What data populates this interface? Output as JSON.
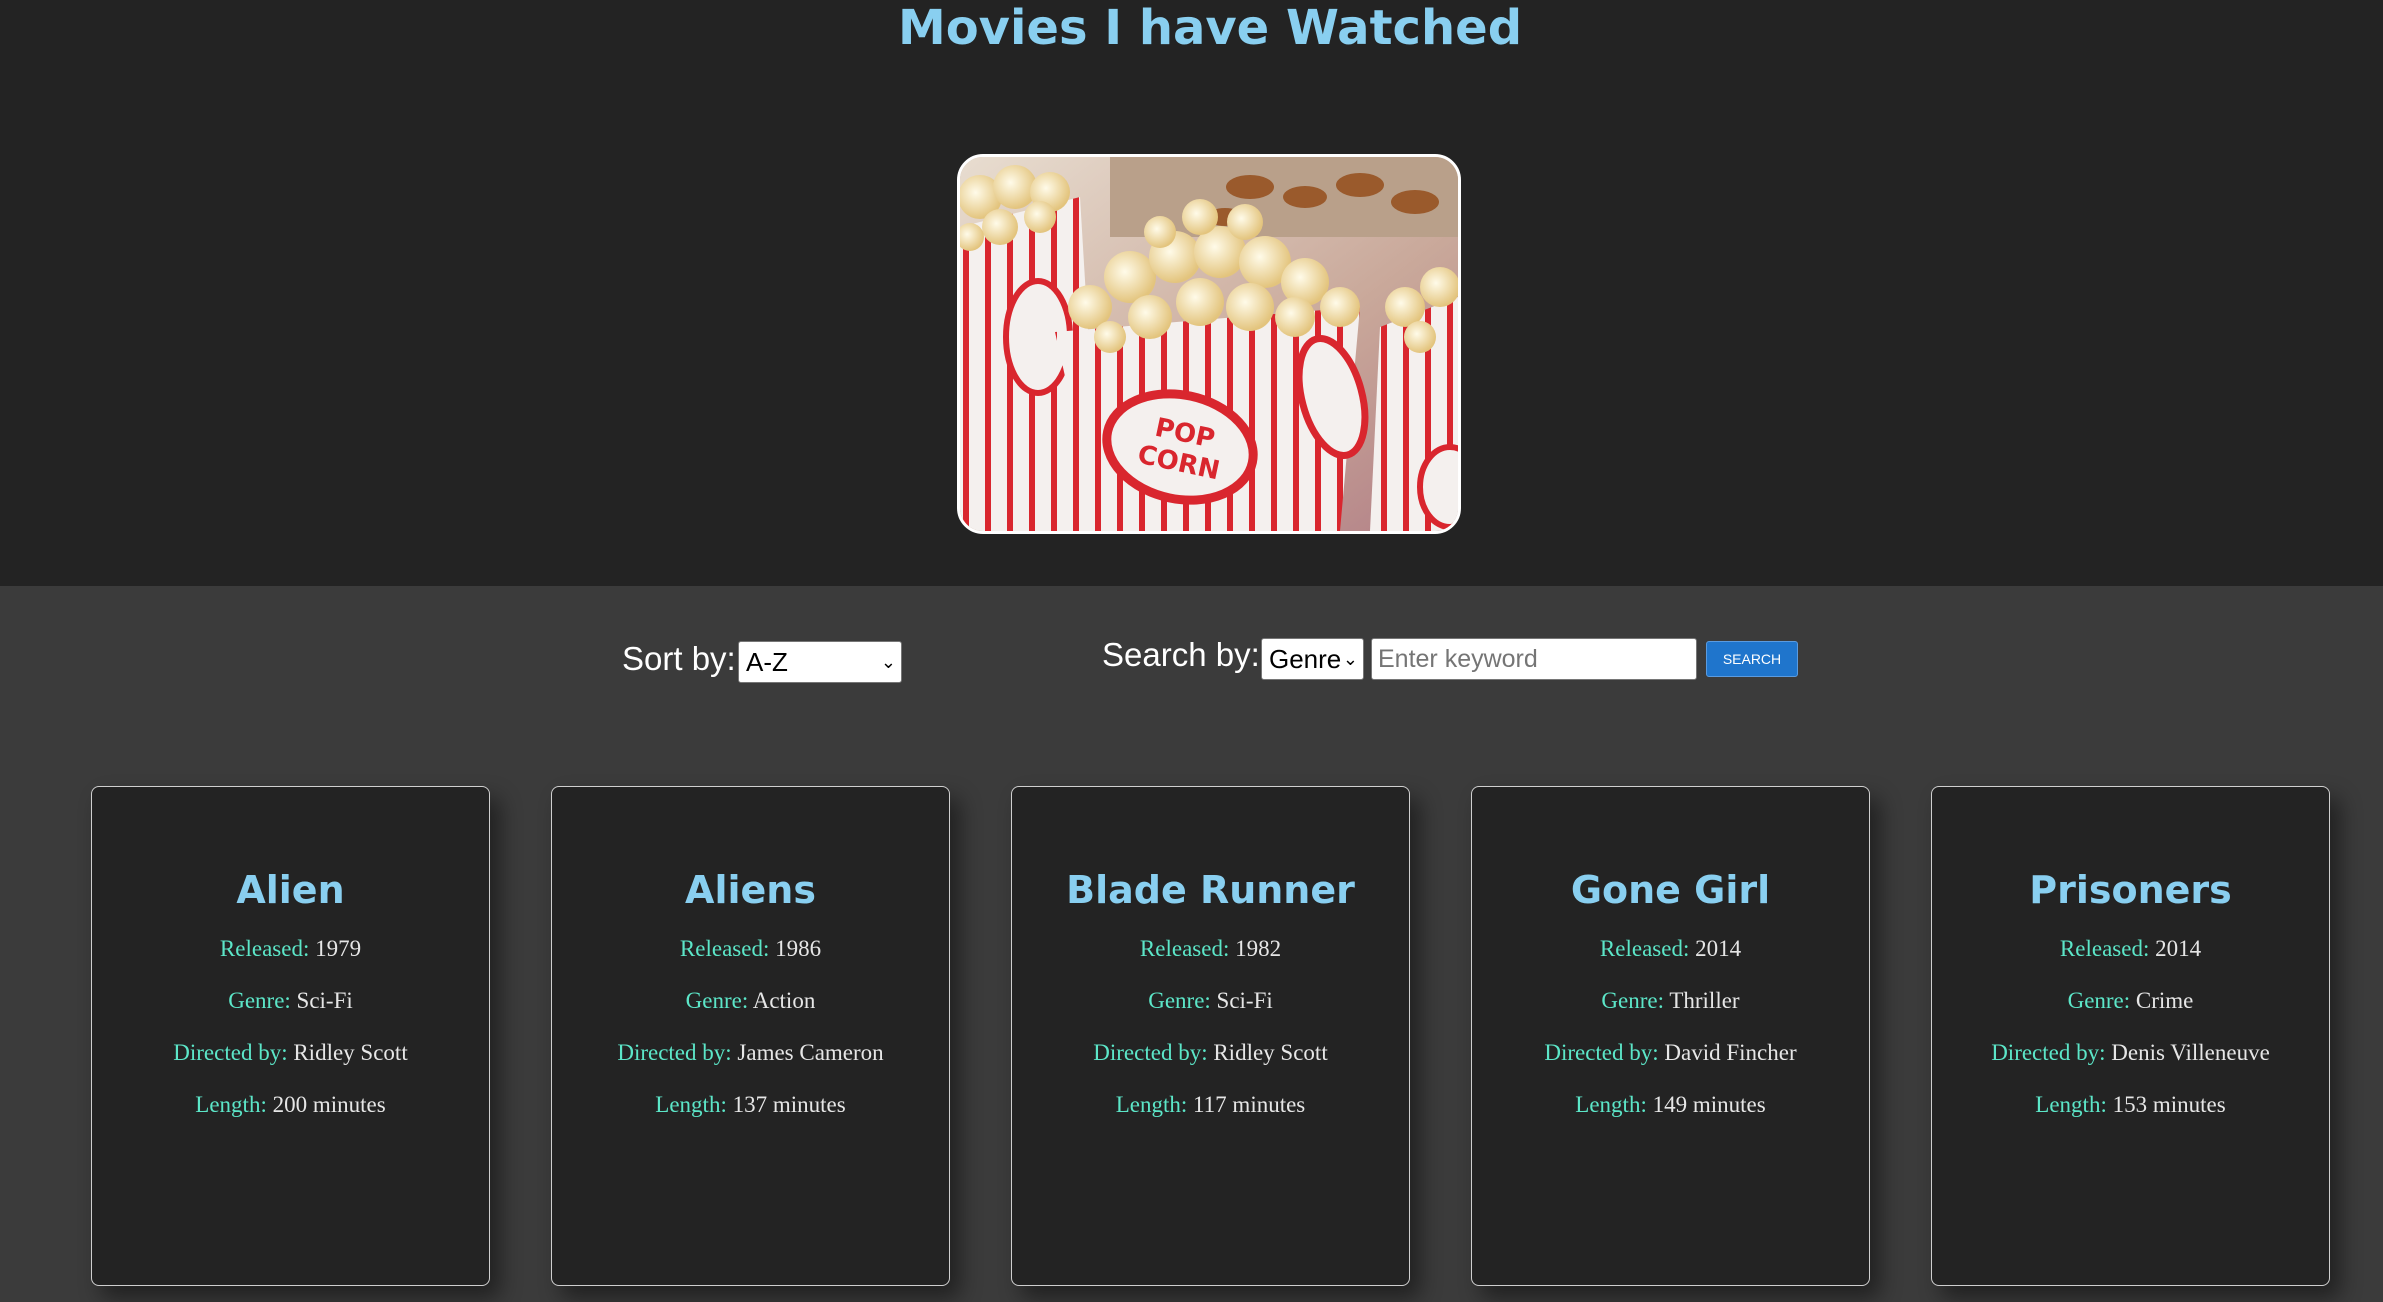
{
  "page": {
    "title": "Movies I have Watched"
  },
  "hero_image": {
    "description_icon": "popcorn-image",
    "box_text_line1": "POP",
    "box_text_line2": "CORN"
  },
  "controls": {
    "sort_label": "Sort by:",
    "sort_value": "A-Z",
    "search_label": "Search by:",
    "search_field_value": "Genre",
    "search_placeholder": "Enter keyword",
    "search_button": "SEARCH"
  },
  "field_labels": {
    "released": "Released:",
    "genre": "Genre:",
    "director": "Directed by:",
    "length": "Length:"
  },
  "movies": [
    {
      "title": "Alien",
      "released": "1979",
      "genre": "Sci-Fi",
      "director": "Ridley Scott",
      "length": "200 minutes"
    },
    {
      "title": "Aliens",
      "released": "1986",
      "genre": "Action",
      "director": "James Cameron",
      "length": "137 minutes"
    },
    {
      "title": "Blade Runner",
      "released": "1982",
      "genre": "Sci-Fi",
      "director": "Ridley Scott",
      "length": "117 minutes"
    },
    {
      "title": "Gone Girl",
      "released": "2014",
      "genre": "Thriller",
      "director": "David Fincher",
      "length": "149 minutes"
    },
    {
      "title": "Prisoners",
      "released": "2014",
      "genre": "Crime",
      "director": "Denis Villeneuve",
      "length": "153 minutes"
    }
  ],
  "colors": {
    "header_bg": "#232323",
    "page_bg": "#3b3b3b",
    "title": "#89cff0",
    "label": "#5ce6c8",
    "button": "#1f75cc"
  }
}
